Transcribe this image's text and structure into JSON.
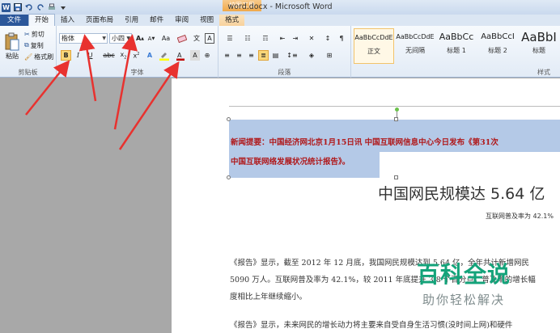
{
  "window": {
    "title": "word.docx - Microsoft Word",
    "context_badge": "校图工目",
    "accent": "#2b579a"
  },
  "qat": {
    "word_icon": "W",
    "save_icon": "save-icon",
    "undo_icon": "undo-icon",
    "redo_icon": "redo-icon"
  },
  "tabs": [
    {
      "label": "文件"
    },
    {
      "label": "开始"
    },
    {
      "label": "插入"
    },
    {
      "label": "页面布局"
    },
    {
      "label": "引用"
    },
    {
      "label": "邮件"
    },
    {
      "label": "审阅"
    },
    {
      "label": "视图"
    },
    {
      "label": "格式"
    }
  ],
  "clipboard": {
    "paste": "粘贴",
    "cut": "剪切",
    "copy": "复制",
    "format_painter": "格式刷",
    "group_label": "剪贴板"
  },
  "font": {
    "name": "楷体",
    "size": "小四",
    "bold": "B",
    "italic": "I",
    "underline": "U",
    "grow": "A",
    "shrink": "A",
    "case": "Aa",
    "group_label": "字体",
    "font_color": "#c00000",
    "highlight_color": "#ffff00"
  },
  "paragraph": {
    "group_label": "段落"
  },
  "styles": {
    "group_label": "样式",
    "items": [
      {
        "sample": "AaBbCcDdE",
        "name": "正文"
      },
      {
        "sample": "AaBbCcDdE",
        "name": "无间隔"
      },
      {
        "sample": "AaBbCc",
        "name": "标题 1"
      },
      {
        "sample": "AaBbCcI",
        "name": "标题 2"
      },
      {
        "sample": "AaBbI",
        "name": "标题"
      }
    ]
  },
  "document": {
    "textbox_line1": "新闻提要：中国经济网北京1月15日讯 中国互联网信息中心今日发布《第31次",
    "textbox_line2": "中国互联网络发展状况统计报告》。",
    "title": "中国网民规模达 5.64 亿",
    "subtitle": "互联网普及率为 42.1%",
    "p1_line1": "《报告》显示，截至 2012 年 12 月底，我国网民规模达到 5.64 亿，全年共计新增网民",
    "p1_line2": "5090 万人。互联网普及率为 42.1%，较 2011 年底提升 3.8 个百分点，普及率的增长幅",
    "p1_line3": "度相比上年继续缩小。",
    "p2_line1": "《报告》显示，未来网民的增长动力将主要来自受自身生活习惯(没时间上网)和硬件"
  },
  "watermark": {
    "main": "百科全说",
    "sub": "助你轻松解决"
  }
}
